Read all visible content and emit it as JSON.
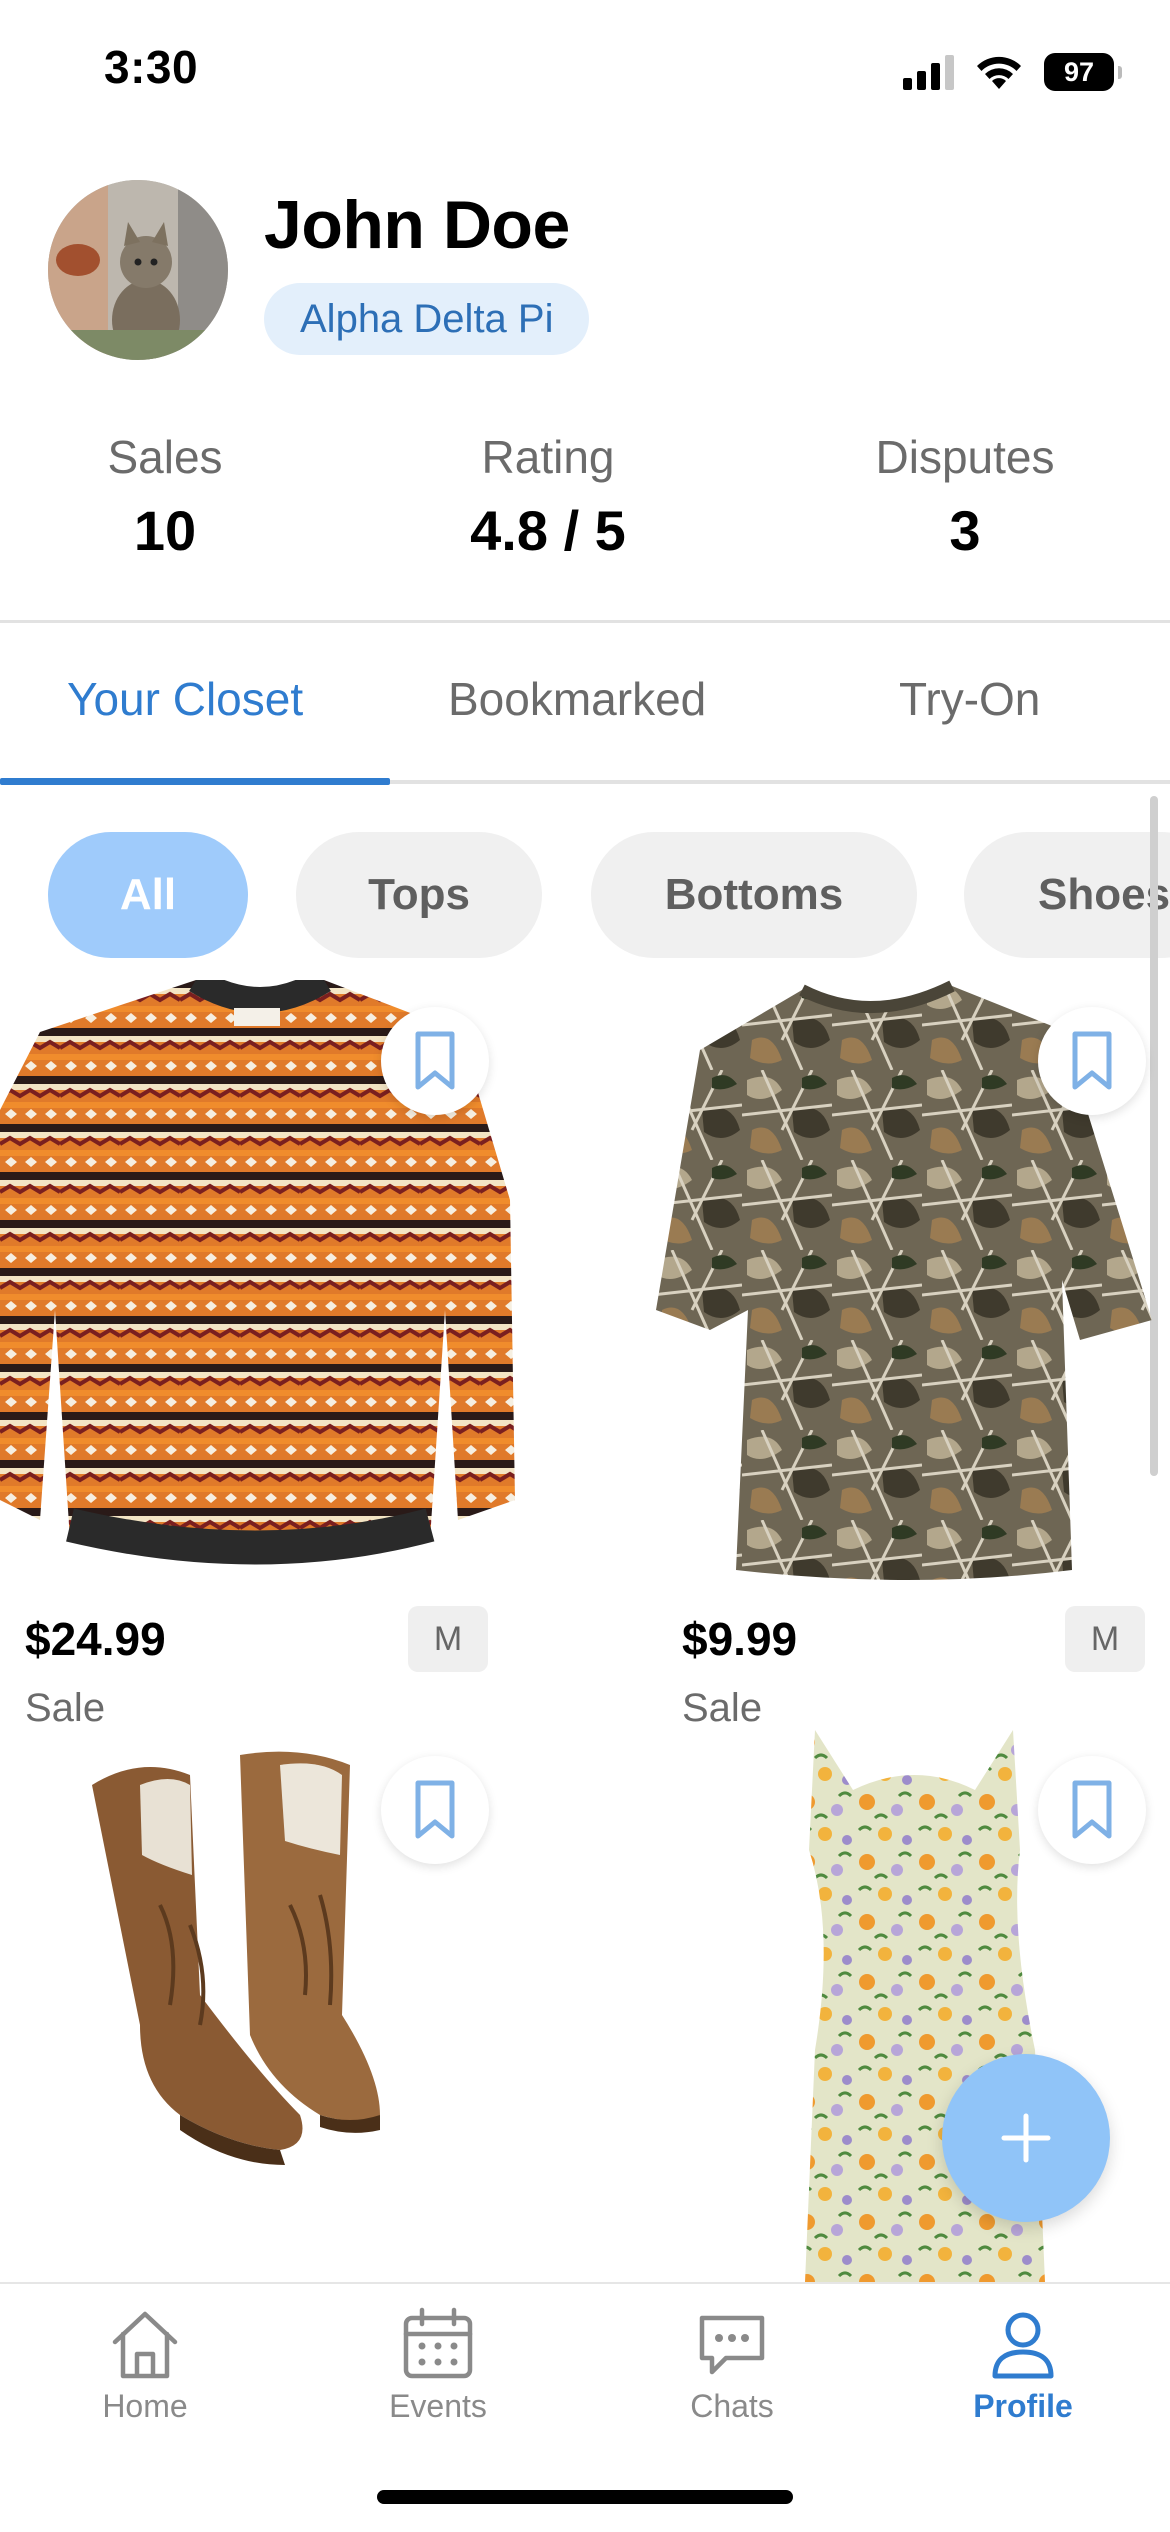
{
  "status_bar": {
    "time": "3:30",
    "battery": "97"
  },
  "profile": {
    "name": "John Doe",
    "organization": "Alpha Delta Pi"
  },
  "stats": [
    {
      "label": "Sales",
      "value": "10"
    },
    {
      "label": "Rating",
      "value": "4.8 / 5"
    },
    {
      "label": "Disputes",
      "value": "3"
    }
  ],
  "tabs": [
    {
      "label": "Your Closet",
      "active": true
    },
    {
      "label": "Bookmarked",
      "active": false
    },
    {
      "label": "Try-On",
      "active": false
    }
  ],
  "filters": [
    {
      "label": "All",
      "active": true
    },
    {
      "label": "Tops",
      "active": false
    },
    {
      "label": "Bottoms",
      "active": false
    },
    {
      "label": "Shoes",
      "active": false
    }
  ],
  "items": [
    {
      "name": "fair-isle sweater",
      "price": "$24.99",
      "size": "M",
      "status": "Sale"
    },
    {
      "name": "camo t-shirt",
      "price": "$9.99",
      "size": "M",
      "status": "Sale"
    },
    {
      "name": "cowboy boots"
    },
    {
      "name": "floral dress"
    }
  ],
  "bottom_nav": [
    {
      "label": "Home",
      "icon": "home-icon",
      "active": false
    },
    {
      "label": "Events",
      "icon": "calendar-icon",
      "active": false
    },
    {
      "label": "Chats",
      "icon": "chat-icon",
      "active": false
    },
    {
      "label": "Profile",
      "icon": "profile-icon",
      "active": true
    }
  ],
  "colors": {
    "accent": "#2f7ccf",
    "chip_active": "#9fcbfb",
    "fab": "#90c4f8",
    "badge_bg": "#e3effb"
  }
}
